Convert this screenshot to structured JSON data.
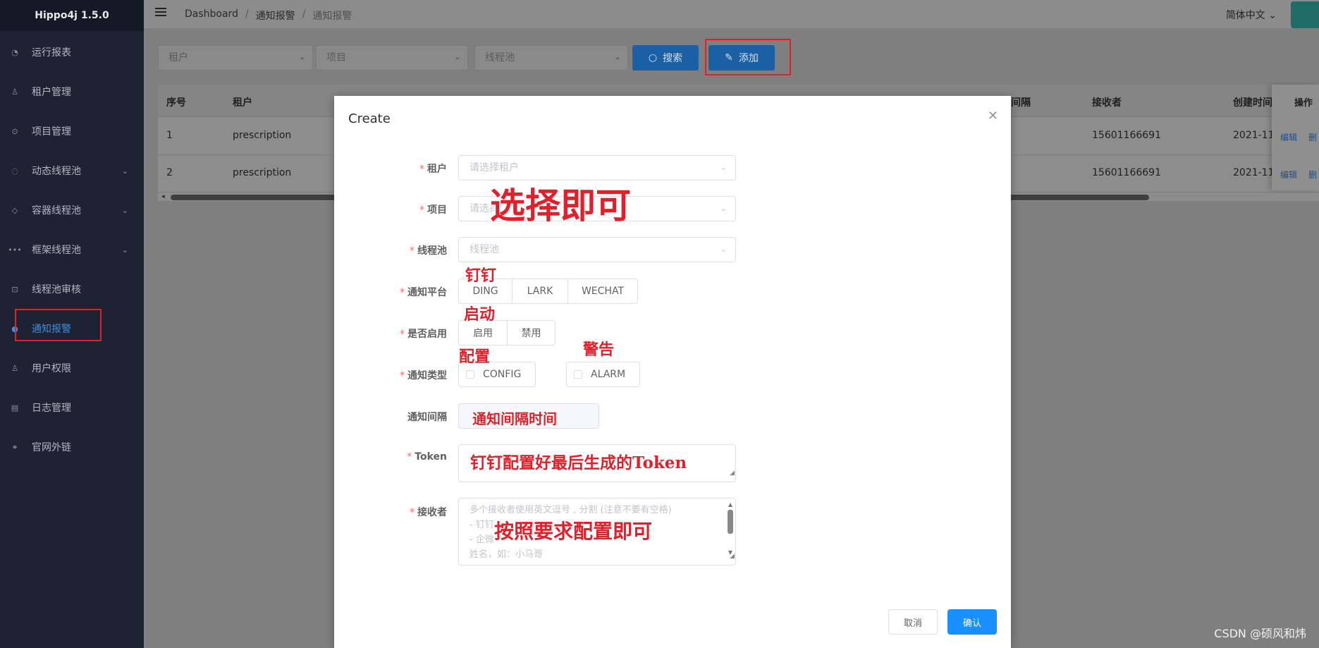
{
  "app": {
    "title": "Hippo4j 1.5.0"
  },
  "sidebar": {
    "items": [
      {
        "label": "运行报表",
        "icon": "dashboard-icon"
      },
      {
        "label": "租户管理",
        "icon": "user-icon"
      },
      {
        "label": "项目管理",
        "icon": "project-icon"
      },
      {
        "label": "动态线程池",
        "icon": "fire-icon"
      },
      {
        "label": "容器线程池",
        "icon": "cube-icon"
      },
      {
        "label": "框架线程池",
        "icon": "more-icon"
      },
      {
        "label": "线程池审核",
        "icon": "audit-icon"
      },
      {
        "label": "通知报警",
        "icon": "bell-icon"
      },
      {
        "label": "用户权限",
        "icon": "person-icon"
      },
      {
        "label": "日志管理",
        "icon": "log-icon"
      },
      {
        "label": "官网外链",
        "icon": "link-icon"
      }
    ]
  },
  "header": {
    "breadcrumb": [
      "Dashboard",
      "通知报警",
      "通知报警"
    ],
    "language": "简体中文"
  },
  "toolbar": {
    "tenant_placeholder": "租户",
    "project_placeholder": "项目",
    "pool_placeholder": "线程池",
    "search_label": "搜索",
    "add_label": "添加"
  },
  "table": {
    "headers": {
      "index": "序号",
      "tenant": "租户",
      "interval_partial": "间隔",
      "receiver": "接收者",
      "created": "创建时间",
      "ops": "操作"
    },
    "rows": [
      {
        "index": "1",
        "tenant": "prescription",
        "receiver": "15601166691",
        "created": "2021-11-",
        "edit": "编辑",
        "delete": "删"
      },
      {
        "index": "2",
        "tenant": "prescription",
        "receiver": "15601166691",
        "created": "2021-11-",
        "edit": "编辑",
        "delete": "删"
      }
    ]
  },
  "dialog": {
    "title": "Create",
    "labels": {
      "tenant": "租户",
      "project": "项目",
      "pool": "线程池",
      "platform": "通知平台",
      "enable": "是否启用",
      "type": "通知类型",
      "interval": "通知间隔",
      "token": "Token",
      "receiver": "接收者"
    },
    "placeholders": {
      "tenant": "请选择租户",
      "project": "请选择",
      "pool": "线程池"
    },
    "platforms": [
      "DING",
      "LARK",
      "WECHAT"
    ],
    "enable_options": [
      "启用",
      "禁用"
    ],
    "types": [
      "CONFIG",
      "ALARM"
    ],
    "receiver_lines": [
      "多个接收者使用英文逗号 , 分割 (注意不要有空格)",
      "- 钉钉",
      "- 企微",
      "姓名，如：小马哥"
    ],
    "cancel_label": "取消",
    "confirm_label": "确认"
  },
  "annotations": {
    "select": "选择即可",
    "dingding": "钉钉",
    "qidong": "启动",
    "peizhi": "配置",
    "jinggao": "警告",
    "interval": "通知间隔时间",
    "token": "钉钉配置好最后生成的Token",
    "receiver": "按照要求配置即可"
  },
  "watermark": "CSDN @硕风和炜"
}
